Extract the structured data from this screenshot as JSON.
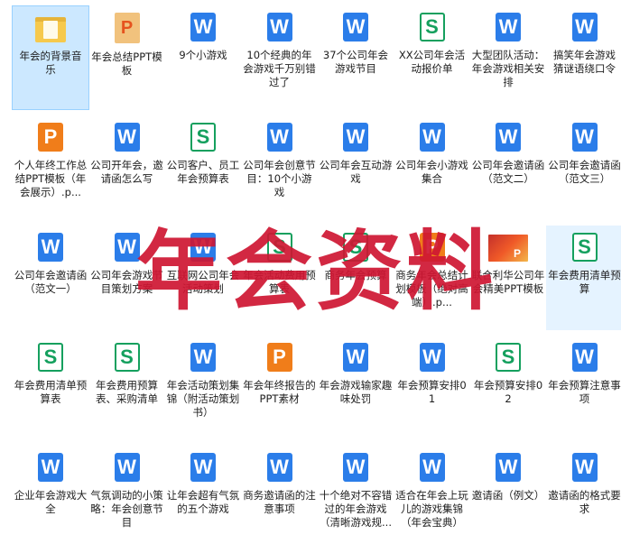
{
  "files": [
    {
      "type": "folder",
      "label": "年会的背景音乐",
      "selected": true
    },
    {
      "type": "ppt",
      "label": "年会总结PPT模板"
    },
    {
      "type": "word",
      "label": "9个小游戏"
    },
    {
      "type": "word",
      "label": "10个经典的年会游戏千万别错过了"
    },
    {
      "type": "word",
      "label": "37个公司年会游戏节目"
    },
    {
      "type": "sheet",
      "label": "XX公司年会活动报价单"
    },
    {
      "type": "word",
      "label": "大型团队活动：年会游戏相关安排"
    },
    {
      "type": "word",
      "label": "搞笑年会游戏 猜谜语绕口令"
    },
    {
      "type": "pres",
      "label": "个人年终工作总结PPT模板（年会展示）.p..."
    },
    {
      "type": "word",
      "label": "公司开年会，邀请函怎么写"
    },
    {
      "type": "sheet",
      "label": "公司客户、员工年会预算表"
    },
    {
      "type": "word",
      "label": "公司年会创意节目：10个小游戏"
    },
    {
      "type": "word",
      "label": "公司年会互动游戏"
    },
    {
      "type": "word",
      "label": "公司年会小游戏集合"
    },
    {
      "type": "word",
      "label": "公司年会邀请函（范文二）"
    },
    {
      "type": "word",
      "label": "公司年会邀请函（范文三）"
    },
    {
      "type": "word",
      "label": "公司年会邀请函（范文一）"
    },
    {
      "type": "word",
      "label": "公司年会游戏节目策划方案"
    },
    {
      "type": "word",
      "label": "互联网公司年会活动策划"
    },
    {
      "type": "sheet",
      "label": "年会活动费用预算表"
    },
    {
      "type": "sheet",
      "label": "商务年会预算"
    },
    {
      "type": "pres",
      "label": "商务年会总结计划模板（绝对高端）.p..."
    },
    {
      "type": "thumb",
      "label": "联合利华公司年会精美PPT模板"
    },
    {
      "type": "sheet",
      "label": "年会费用清单预算",
      "hover": true
    },
    {
      "type": "sheet",
      "label": "年会费用清单预算表"
    },
    {
      "type": "sheet",
      "label": "年会费用预算表、采购清单"
    },
    {
      "type": "word",
      "label": "年会活动策划集锦（附活动策划书）"
    },
    {
      "type": "pres",
      "label": "年会年终报告的PPT素材"
    },
    {
      "type": "word",
      "label": "年会游戏输家趣味处罚"
    },
    {
      "type": "word",
      "label": "年会预算安排01"
    },
    {
      "type": "sheet",
      "label": "年会预算安排02"
    },
    {
      "type": "word",
      "label": "年会预算注意事项"
    },
    {
      "type": "word",
      "label": "企业年会游戏大全"
    },
    {
      "type": "word",
      "label": "气氛调动的小策略：年会创意节目"
    },
    {
      "type": "word",
      "label": "让年会超有气氛的五个游戏"
    },
    {
      "type": "word",
      "label": "商务邀请函的注意事项"
    },
    {
      "type": "word",
      "label": "十个绝对不容错过的年会游戏（清晰游戏规..."
    },
    {
      "type": "word",
      "label": "适合在年会上玩儿的游戏集锦（年会宝典）"
    },
    {
      "type": "word",
      "label": "邀请函（例文）"
    },
    {
      "type": "word",
      "label": "邀请函的格式要求"
    }
  ],
  "icon_glyphs": {
    "word": "W",
    "sheet": "S",
    "pres": "P",
    "ppt": "P",
    "thumb": "P"
  },
  "icon_names": {
    "folder": "folder-icon",
    "ppt": "ppt-file-icon",
    "word": "word-document-icon",
    "sheet": "spreadsheet-icon",
    "pres": "presentation-icon",
    "thumb": "ppt-thumbnail-icon"
  },
  "colors": {
    "word": "#2b7de9",
    "sheet": "#15a05e",
    "pres": "#f07d1a",
    "selection": "#cce8ff",
    "watermark": "#ce1632"
  },
  "watermark": "年会资料"
}
